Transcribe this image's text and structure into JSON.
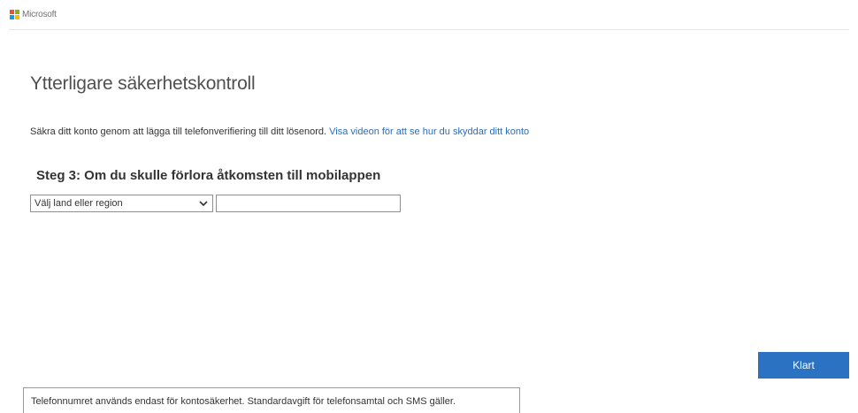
{
  "header": {
    "brand": "Microsoft",
    "logo_colors": [
      "#f25022",
      "#7fba00",
      "#00a4ef",
      "#ffb900"
    ]
  },
  "main": {
    "title": "Ytterligare säkerhetskontroll",
    "intro_text": "Säkra ditt konto genom att lägga till telefonverifiering till ditt lösenord.",
    "intro_link": "Visa videon för att se hur du skyddar ditt konto",
    "step_title": "Steg 3: Om du skulle förlora åtkomsten till mobilappen",
    "country_select": {
      "selected": "Välj land eller region",
      "icon": "chevron-down-icon"
    },
    "phone_input": {
      "value": "",
      "placeholder": ""
    },
    "done_label": "Klart"
  },
  "footer": {
    "notice": "Telefonnumret används endast för kontosäkerhet. Standardavgift för telefonsamtal och SMS gäller."
  },
  "colors": {
    "accent": "#2b72c2",
    "link": "#2a6ebb"
  }
}
